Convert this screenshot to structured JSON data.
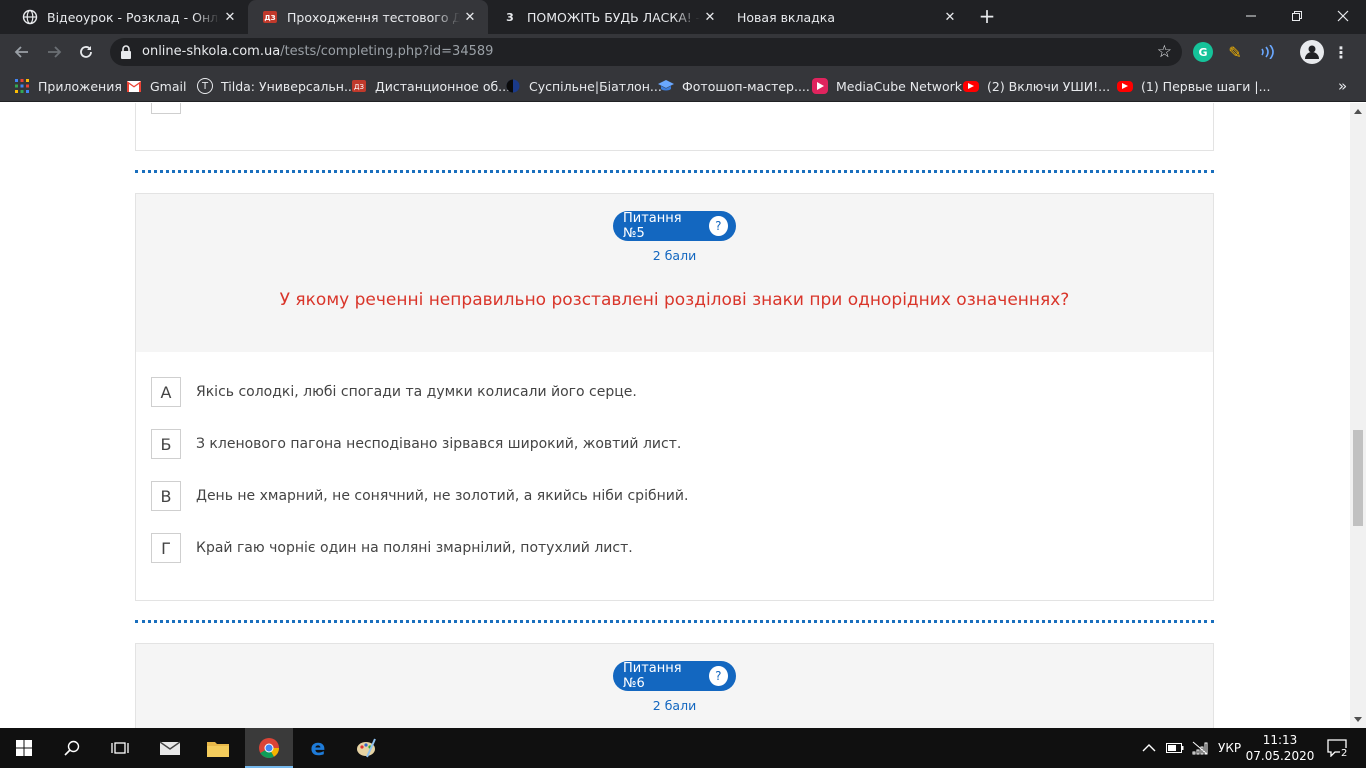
{
  "browser": {
    "tabs": [
      {
        "title": "Відеоурок - Розклад - Онлайн-Ш",
        "icon": "globe-icon"
      },
      {
        "title": "Проходження тестового ДЗ - Он",
        "icon": "test-icon"
      },
      {
        "title": "ПОМОЖІТЬ БУДЬ ЛАСКА! - Шко",
        "icon": "znanija-icon",
        "favicon_text": "3"
      },
      {
        "title": "Новая вкладка",
        "icon": ""
      }
    ],
    "url_host": "online-shkola.com.ua",
    "url_path": "/tests/completing.php?id=34589",
    "bookmarks": [
      {
        "label": "Приложения",
        "icon": "apps-grid-icon"
      },
      {
        "label": "Gmail",
        "icon": "gmail-icon"
      },
      {
        "label": "Tilda: Универсальн...",
        "icon": "tilda-icon",
        "icon_text": "T"
      },
      {
        "label": "Дистанционное об...",
        "icon": "test-icon"
      },
      {
        "label": "Суспільне|Біатлон...",
        "icon": "suspilne-icon"
      },
      {
        "label": "Фотошоп-мастер....",
        "icon": "photoshop-icon"
      },
      {
        "label": "MediaCube Network",
        "icon": "mediacube-icon"
      },
      {
        "label": "(2) Включи УШИ!...",
        "icon": "youtube-icon"
      },
      {
        "label": "(1) Первые шаги |...",
        "icon": "youtube-icon"
      }
    ],
    "more": "»"
  },
  "question5": {
    "badge": "Питання №5",
    "help": "?",
    "points": "2 бали",
    "text": "У якому реченні неправильно розставлені розділові знаки при однорідних означеннях?",
    "options": [
      {
        "letter": "А",
        "text": "Якісь солодкі, любі спогади та думки колисали його серце."
      },
      {
        "letter": "Б",
        "text": "З кленового пагона несподівано зірвався широкий, жовтий лист."
      },
      {
        "letter": "В",
        "text": "День не хмарний, не сонячний, не золотий, а якийсь ніби срібний."
      },
      {
        "letter": "Г",
        "text": "Край гаю чорніє один на поляні змарнілий, потухлий лист."
      }
    ]
  },
  "question6": {
    "badge": "Питання №6",
    "help": "?",
    "points": "2 бали"
  },
  "taskbar": {
    "language": "УКР",
    "time": "11:13",
    "date": "07.05.2020",
    "notifications": "2"
  },
  "colors": {
    "accent_blue": "#1367c0",
    "question_red": "#d9352a",
    "chrome_dark": "#202124",
    "chrome_toolbar": "#35363a"
  }
}
